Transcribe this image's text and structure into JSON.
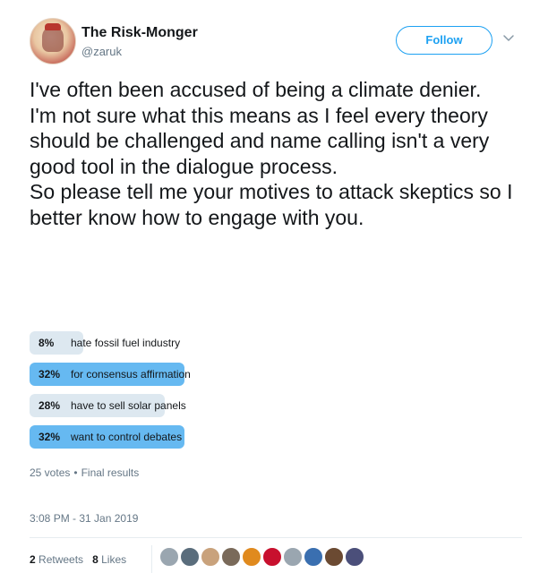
{
  "author": {
    "display_name": "The Risk-Monger",
    "handle": "@zaruk"
  },
  "follow_label": "Follow",
  "tweet_lines": [
    "I've often been accused of being a climate denier.",
    "I'm not sure what this means as I feel every theory should be challenged and name calling isn't a very good tool in the dialogue process.",
    "So please tell me your motives to attack skeptics so I better know how to engage with you."
  ],
  "poll": {
    "options": [
      {
        "percent": "8%",
        "label": "hate fossil fuel industry",
        "fraction": 0.08
      },
      {
        "percent": "32%",
        "label": "for consensus affirmation",
        "fraction": 0.32
      },
      {
        "percent": "28%",
        "label": "have to sell solar panels",
        "fraction": 0.28
      },
      {
        "percent": "32%",
        "label": "want to control debates",
        "fraction": 0.32
      }
    ],
    "votes": "25 votes",
    "separator": "•",
    "status": "Final results"
  },
  "timestamp": "3:08 PM - 31 Jan 2019",
  "stats": {
    "retweets_count": "2",
    "retweets_label": "Retweets",
    "likes_count": "8",
    "likes_label": "Likes"
  },
  "colors": {
    "accent": "#1da1f2",
    "winning_bar": "#66b9f1",
    "losing_bar": "#dde8f0"
  },
  "liker_avatars": [
    "liker-avatar-1",
    "liker-avatar-2",
    "liker-avatar-3",
    "liker-avatar-4",
    "liker-avatar-5",
    "liker-avatar-6",
    "liker-avatar-7",
    "liker-avatar-8",
    "liker-avatar-9",
    "liker-avatar-10"
  ]
}
